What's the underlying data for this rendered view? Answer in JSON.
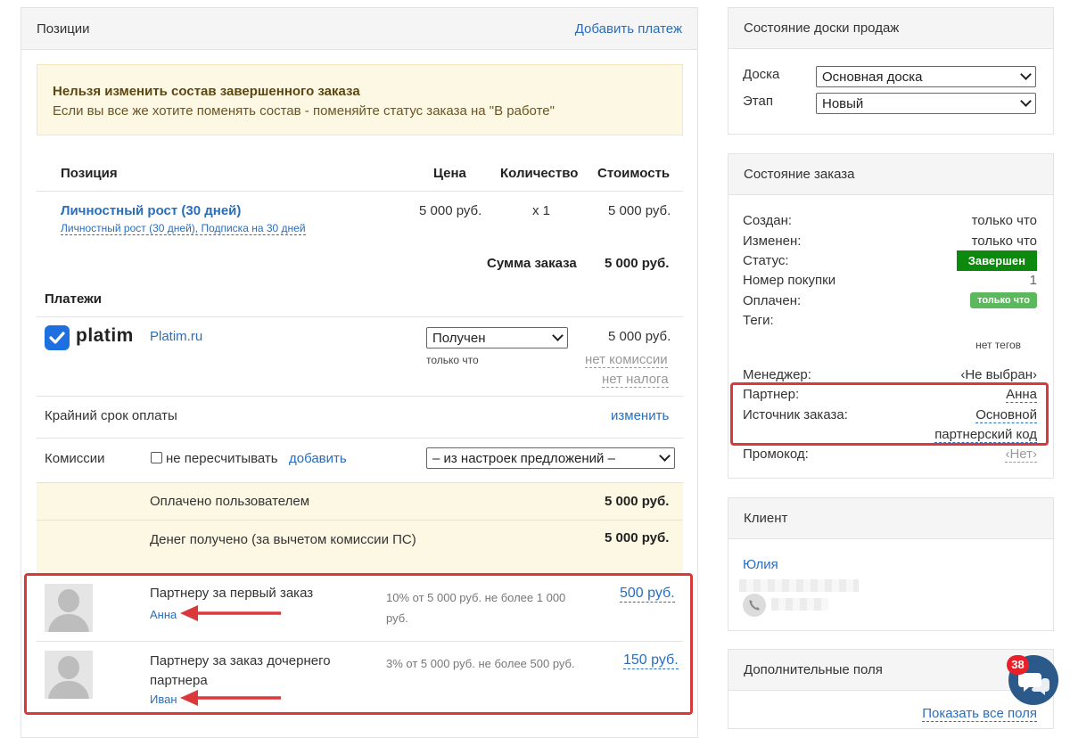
{
  "positions": {
    "title": "Позиции",
    "add_payment": "Добавить платеж",
    "warning_title": "Нельзя изменить состав завершенного заказа",
    "warning_text": "Если вы все же хотите поменять состав - поменяйте статус заказа на \"В работе\"",
    "headers": {
      "position": "Позиция",
      "price": "Цена",
      "qty": "Количество",
      "cost": "Стоимость"
    },
    "item": {
      "name": "Личностный рост (30 дней)",
      "sub": "Личностный рост (30 дней), Подписка на 30 дней",
      "price": "5 000 руб.",
      "qty": "x 1",
      "cost": "5 000 руб."
    },
    "sum_label": "Сумма заказа",
    "sum_value": "5 000 руб."
  },
  "payments": {
    "title": "Платежи",
    "logo_text": "platim",
    "system": "Platim.ru",
    "status_value": "Получен",
    "time": "только что",
    "amount": "5 000 руб.",
    "no_commission": "нет комиссии",
    "no_tax": "нет налога"
  },
  "deadline": {
    "label": "Крайний срок оплаты",
    "change": "изменить"
  },
  "commissions": {
    "label": "Комиссии",
    "no_recalc": "не пересчитывать",
    "add": "добавить",
    "select_value": "– из настроек предложений –"
  },
  "totals": {
    "paid_label": "Оплачено пользователем",
    "paid_value": "5 000 руб.",
    "received_label": "Денег получено (за вычетом комиссии ПС)",
    "received_value": "5 000 руб."
  },
  "partners": [
    {
      "title": "Партнеру за первый заказ",
      "name": "Анна",
      "desc": "10% от 5 000 руб. не более 1 000 руб.",
      "amount": "500 руб."
    },
    {
      "title": "Партнеру за заказ дочернего партнера",
      "name": "Иван",
      "desc": "3% от 5 000 руб. не более 500 руб.",
      "amount": "150 руб."
    }
  ],
  "board": {
    "title": "Состояние доски продаж",
    "board_label": "Доска",
    "board_value": "Основная доска",
    "stage_label": "Этап",
    "stage_value": "Новый"
  },
  "order_state": {
    "title": "Состояние заказа",
    "created_label": "Создан:",
    "created_value": "только что",
    "modified_label": "Изменен:",
    "modified_value": "только что",
    "status_label": "Статус:",
    "status_value": "Завершен",
    "purchase_label": "Номер покупки",
    "purchase_value": "1",
    "paid_label": "Оплачен:",
    "paid_value": "только что",
    "tags_label": "Теги:",
    "tags_value": "нет тегов",
    "manager_label": "Менеджер:",
    "manager_value": "‹Не выбран›",
    "partner_label": "Партнер:",
    "partner_value": "Анна",
    "source_label": "Источник заказа:",
    "source_value_1": "Основной",
    "source_value_2": "партнерский код",
    "promo_label": "Промокод:",
    "promo_value": "‹Нет›"
  },
  "client": {
    "title": "Клиент",
    "name": "Юлия"
  },
  "extra": {
    "title": "Дополнительные поля",
    "show_all": "Показать все поля"
  },
  "chat": {
    "badge": "38"
  },
  "colors": {
    "link": "#2a6ebb",
    "status_green": "#0d8a0d",
    "paid_green": "#5cb85c",
    "red": "#d9393b",
    "chat": "#2b5a8a"
  }
}
